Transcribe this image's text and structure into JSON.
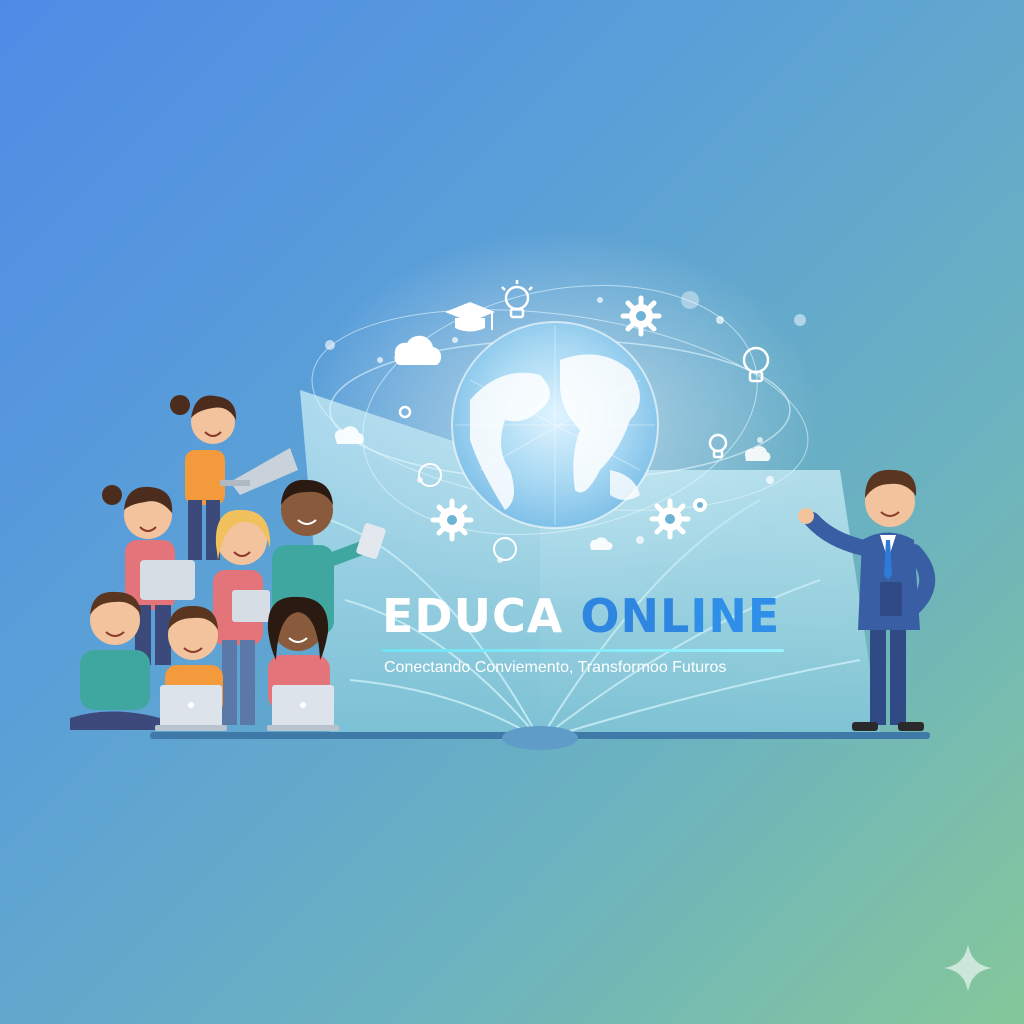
{
  "brand": {
    "word1": "EDUCA ",
    "word2_part1": "ONL",
    "word2_part2": "INE",
    "tagline": "Conectando Conviemento, Transformoo Futuros"
  },
  "colors": {
    "background_start": "#4f8be6",
    "background_end": "#85c79a",
    "title_white": "#ffffff",
    "title_blue": "#2f86e0",
    "accent_cyan": "#6fe3f4"
  },
  "icons": [
    "globe-icon",
    "graduation-cap-icon",
    "lightbulb-icon",
    "gear-icon",
    "cloud-icon",
    "open-book-icon",
    "laptop-icon",
    "tablet-icon",
    "sparkle-icon"
  ]
}
